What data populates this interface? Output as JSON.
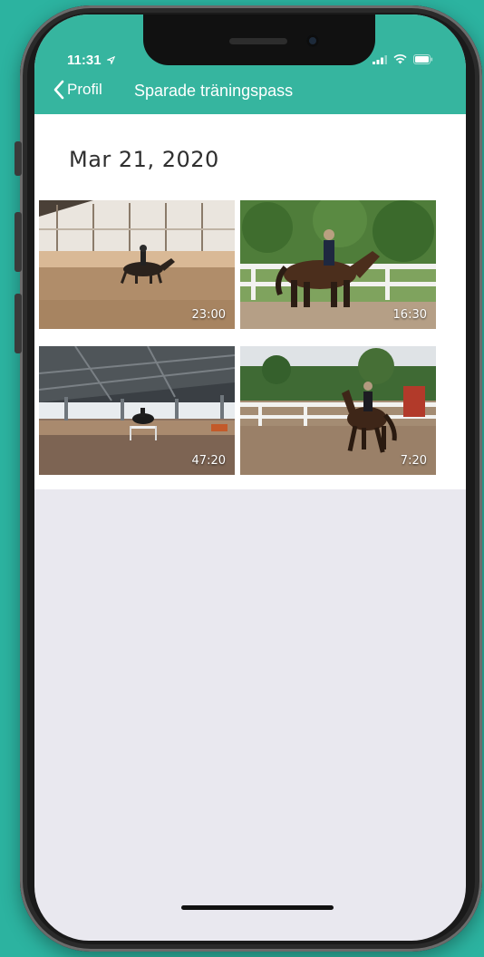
{
  "colors": {
    "background": "#2cb3a0",
    "accent": "#36b59f"
  },
  "status_bar": {
    "time": "11:31",
    "location_icon": "location-arrow-icon",
    "icons": [
      "signal-icon",
      "wifi-icon",
      "battery-icon"
    ]
  },
  "nav": {
    "back_label": "Profil",
    "title": "Sparade träningspass"
  },
  "session": {
    "date": "Mar 21, 2020",
    "videos": [
      {
        "duration": "23:00",
        "scene": "indoor arena, horse cantering"
      },
      {
        "duration": "16:30",
        "scene": "outdoor arena, rider on brown horse"
      },
      {
        "duration": "47:20",
        "scene": "indoor arena, horse jumping"
      },
      {
        "duration": "7:20",
        "scene": "outdoor arena, horse trotting"
      }
    ]
  }
}
